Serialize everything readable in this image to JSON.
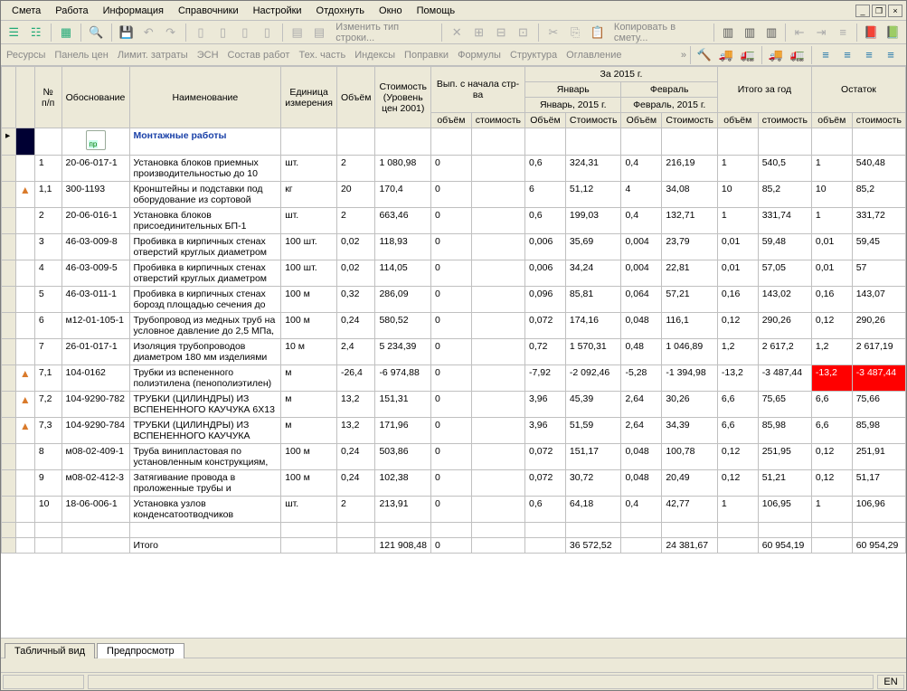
{
  "menu": [
    "Смета",
    "Работа",
    "Информация",
    "Справочники",
    "Настройки",
    "Отдохнуть",
    "Окно",
    "Помощь"
  ],
  "toolbar1": {
    "change_type": "Изменить тип строки...",
    "copy_smeta": "Копировать в смету..."
  },
  "subtoolbar": [
    "Ресурсы",
    "Панель цен",
    "Лимит. затраты",
    "ЭСН",
    "Состав работ",
    "Тех. часть",
    "Индексы",
    "Поправки",
    "Формулы",
    "Структура",
    "Оглавление"
  ],
  "headers": {
    "num": "№ п/п",
    "obosn": "Обоснование",
    "naim": "Наименование",
    "ed": "Единица измерения",
    "obj": "Объём",
    "stoim": "Стоимость (Уровень цен 2001)",
    "vyp": "Вып. с начала стр-ва",
    "za2015": "За 2015 г.",
    "jan": "Январь",
    "jan15": "Январь, 2015 г.",
    "feb": "Февраль",
    "feb15": "Февраль, 2015 г.",
    "itogo_god": "Итого за год",
    "ostatok": "Остаток",
    "sub_obj": "объём",
    "sub_stoim": "стоимость",
    "sub_Obj": "Объём",
    "sub_Stoim": "Стоимость"
  },
  "section_title": "Монтажные работы",
  "rows": [
    {
      "marker": "",
      "n": "1",
      "ob": "20-06-017-1",
      "naim": "Установка блоков приемных производительностью до 10",
      "ed": "шт.",
      "obj": "2",
      "stoim": "1 080,98",
      "v1": "0",
      "v2": "",
      "j1": "0,6",
      "j2": "324,31",
      "f1": "0,4",
      "f2": "216,19",
      "g1": "1",
      "g2": "540,5",
      "o1": "1",
      "o2": "540,48"
    },
    {
      "marker": "▲",
      "n": "1,1",
      "ob": "300-1193",
      "naim": "Кронштейны и подставки под оборудование из сортовой",
      "ed": "кг",
      "obj": "20",
      "stoim": "170,4",
      "v1": "0",
      "v2": "",
      "j1": "6",
      "j2": "51,12",
      "f1": "4",
      "f2": "34,08",
      "g1": "10",
      "g2": "85,2",
      "o1": "10",
      "o2": "85,2"
    },
    {
      "marker": "",
      "n": "2",
      "ob": "20-06-016-1",
      "naim": "Установка блоков присоединительных БП-1",
      "ed": "шт.",
      "obj": "2",
      "stoim": "663,46",
      "v1": "0",
      "v2": "",
      "j1": "0,6",
      "j2": "199,03",
      "f1": "0,4",
      "f2": "132,71",
      "g1": "1",
      "g2": "331,74",
      "o1": "1",
      "o2": "331,72"
    },
    {
      "marker": "",
      "n": "3",
      "ob": "46-03-009-8",
      "naim": "Пробивка в кирпичных стенах отверстий круглых диаметром",
      "ed": "100 шт.",
      "obj": "0,02",
      "stoim": "118,93",
      "v1": "0",
      "v2": "",
      "j1": "0,006",
      "j2": "35,69",
      "f1": "0,004",
      "f2": "23,79",
      "g1": "0,01",
      "g2": "59,48",
      "o1": "0,01",
      "o2": "59,45"
    },
    {
      "marker": "",
      "n": "4",
      "ob": "46-03-009-5",
      "naim": "Пробивка в кирпичных стенах отверстий круглых диаметром",
      "ed": "100 шт.",
      "obj": "0,02",
      "stoim": "114,05",
      "v1": "0",
      "v2": "",
      "j1": "0,006",
      "j2": "34,24",
      "f1": "0,004",
      "f2": "22,81",
      "g1": "0,01",
      "g2": "57,05",
      "o1": "0,01",
      "o2": "57"
    },
    {
      "marker": "",
      "n": "5",
      "ob": "46-03-011-1",
      "naim": "Пробивка в кирпичных стенах борозд площадью сечения до",
      "ed": "100 м",
      "obj": "0,32",
      "stoim": "286,09",
      "v1": "0",
      "v2": "",
      "j1": "0,096",
      "j2": "85,81",
      "f1": "0,064",
      "f2": "57,21",
      "g1": "0,16",
      "g2": "143,02",
      "o1": "0,16",
      "o2": "143,07"
    },
    {
      "marker": "",
      "n": "6",
      "ob": "м12-01-105-1",
      "naim": "Трубопровод из медных труб на условное давление до 2,5 МПа,",
      "ed": "100 м",
      "obj": "0,24",
      "stoim": "580,52",
      "v1": "0",
      "v2": "",
      "j1": "0,072",
      "j2": "174,16",
      "f1": "0,048",
      "f2": "116,1",
      "g1": "0,12",
      "g2": "290,26",
      "o1": "0,12",
      "o2": "290,26"
    },
    {
      "marker": "",
      "n": "7",
      "ob": "26-01-017-1",
      "naim": "Изоляция трубопроводов диаметром 180 мм изделиями",
      "ed": "10 м",
      "obj": "2,4",
      "stoim": "5 234,39",
      "v1": "0",
      "v2": "",
      "j1": "0,72",
      "j2": "1 570,31",
      "f1": "0,48",
      "f2": "1 046,89",
      "g1": "1,2",
      "g2": "2 617,2",
      "o1": "1,2",
      "o2": "2 617,19"
    },
    {
      "marker": "▲",
      "n": "7,1",
      "ob": "104-0162",
      "naim": "Трубки из вспененного полиэтилена (пенополиэтилен)",
      "ed": "м",
      "obj": "-26,4",
      "stoim": "-6 974,88",
      "v1": "0",
      "v2": "",
      "j1": "-7,92",
      "j2": "-2 092,46",
      "f1": "-5,28",
      "f2": "-1 394,98",
      "g1": "-13,2",
      "g2": "-3 487,44",
      "o1": "-13,2",
      "o2": "-3 487,44",
      "neg": true
    },
    {
      "marker": "▲",
      "n": "7,2",
      "ob": "104-9290-782",
      "naim": "ТРУБКИ (ЦИЛИНДРЫ) ИЗ ВСПЕНЕННОГО КАУЧУКА 6Х13",
      "ed": "м",
      "obj": "13,2",
      "stoim": "151,31",
      "v1": "0",
      "v2": "",
      "j1": "3,96",
      "j2": "45,39",
      "f1": "2,64",
      "f2": "30,26",
      "g1": "6,6",
      "g2": "75,65",
      "o1": "6,6",
      "o2": "75,66"
    },
    {
      "marker": "▲",
      "n": "7,3",
      "ob": "104-9290-784",
      "naim": "ТРУБКИ (ЦИЛИНДРЫ) ИЗ ВСПЕНЕННОГО КАУЧУКА",
      "ed": "м",
      "obj": "13,2",
      "stoim": "171,96",
      "v1": "0",
      "v2": "",
      "j1": "3,96",
      "j2": "51,59",
      "f1": "2,64",
      "f2": "34,39",
      "g1": "6,6",
      "g2": "85,98",
      "o1": "6,6",
      "o2": "85,98"
    },
    {
      "marker": "",
      "n": "8",
      "ob": "м08-02-409-1",
      "naim": "Труба винипластовая по установленным конструкциям,",
      "ed": "100 м",
      "obj": "0,24",
      "stoim": "503,86",
      "v1": "0",
      "v2": "",
      "j1": "0,072",
      "j2": "151,17",
      "f1": "0,048",
      "f2": "100,78",
      "g1": "0,12",
      "g2": "251,95",
      "o1": "0,12",
      "o2": "251,91"
    },
    {
      "marker": "",
      "n": "9",
      "ob": "м08-02-412-3",
      "naim": "Затягивание провода в проложенные трубы и",
      "ed": "100 м",
      "obj": "0,24",
      "stoim": "102,38",
      "v1": "0",
      "v2": "",
      "j1": "0,072",
      "j2": "30,72",
      "f1": "0,048",
      "f2": "20,49",
      "g1": "0,12",
      "g2": "51,21",
      "o1": "0,12",
      "o2": "51,17"
    },
    {
      "marker": "",
      "n": "10",
      "ob": "18-06-006-1",
      "naim": "Установка узлов конденсатоотводчиков",
      "ed": "шт.",
      "obj": "2",
      "stoim": "213,91",
      "v1": "0",
      "v2": "",
      "j1": "0,6",
      "j2": "64,18",
      "f1": "0,4",
      "f2": "42,77",
      "g1": "1",
      "g2": "106,95",
      "o1": "1",
      "o2": "106,96"
    }
  ],
  "total": {
    "label": "Итого",
    "stoim": "121 908,48",
    "v1": "0",
    "j2": "36 572,52",
    "f2": "24 381,67",
    "g2": "60 954,19",
    "o2": "60 954,29"
  },
  "bottom_tabs": {
    "table_view": "Табличный вид",
    "preview": "Предпросмотр"
  },
  "status_lang": "EN"
}
